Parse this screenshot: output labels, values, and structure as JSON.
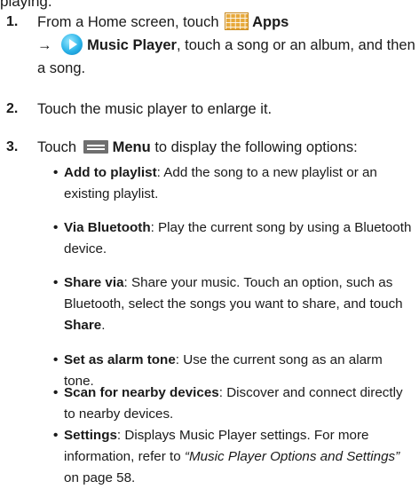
{
  "cutoff_text": "playing.",
  "steps": [
    {
      "num": "1.",
      "before": "From a Home screen, touch",
      "apps_label": "Apps",
      "arrow": "→",
      "music_label": "Music Player",
      "after": ", touch a song or an album, and then a song."
    },
    {
      "num": "2.",
      "text": "Touch the music player to enlarge it."
    },
    {
      "num": "3.",
      "before": "Touch",
      "menu_label": "Menu",
      "after": "to display the following options:"
    }
  ],
  "options": [
    {
      "term": "Add to playlist",
      "desc": ": Add the song to a new playlist or an existing playlist."
    },
    {
      "term": "Via Bluetooth",
      "desc": ": Play the current song by using a Bluetooth device."
    },
    {
      "term": "Share via",
      "desc": ": Share your music. Touch an option, such as Bluetooth, select the songs you want to share, and touch ",
      "desc_bold_end": "Share",
      "desc_end": "."
    },
    {
      "term": "Set as alarm tone",
      "desc": ": Use the current song as an alarm tone."
    },
    {
      "term": "Scan for nearby devices",
      "desc": ": Discover and connect directly to nearby devices."
    },
    {
      "term": "Settings",
      "desc": ": Displays Music Player settings. For more information, refer to ",
      "ref": "“Music Player Options and Settings”",
      "desc_end": " on page 58."
    }
  ],
  "icons": {
    "apps": "apps-grid-icon",
    "music": "music-player-icon",
    "menu": "menu-icon"
  }
}
